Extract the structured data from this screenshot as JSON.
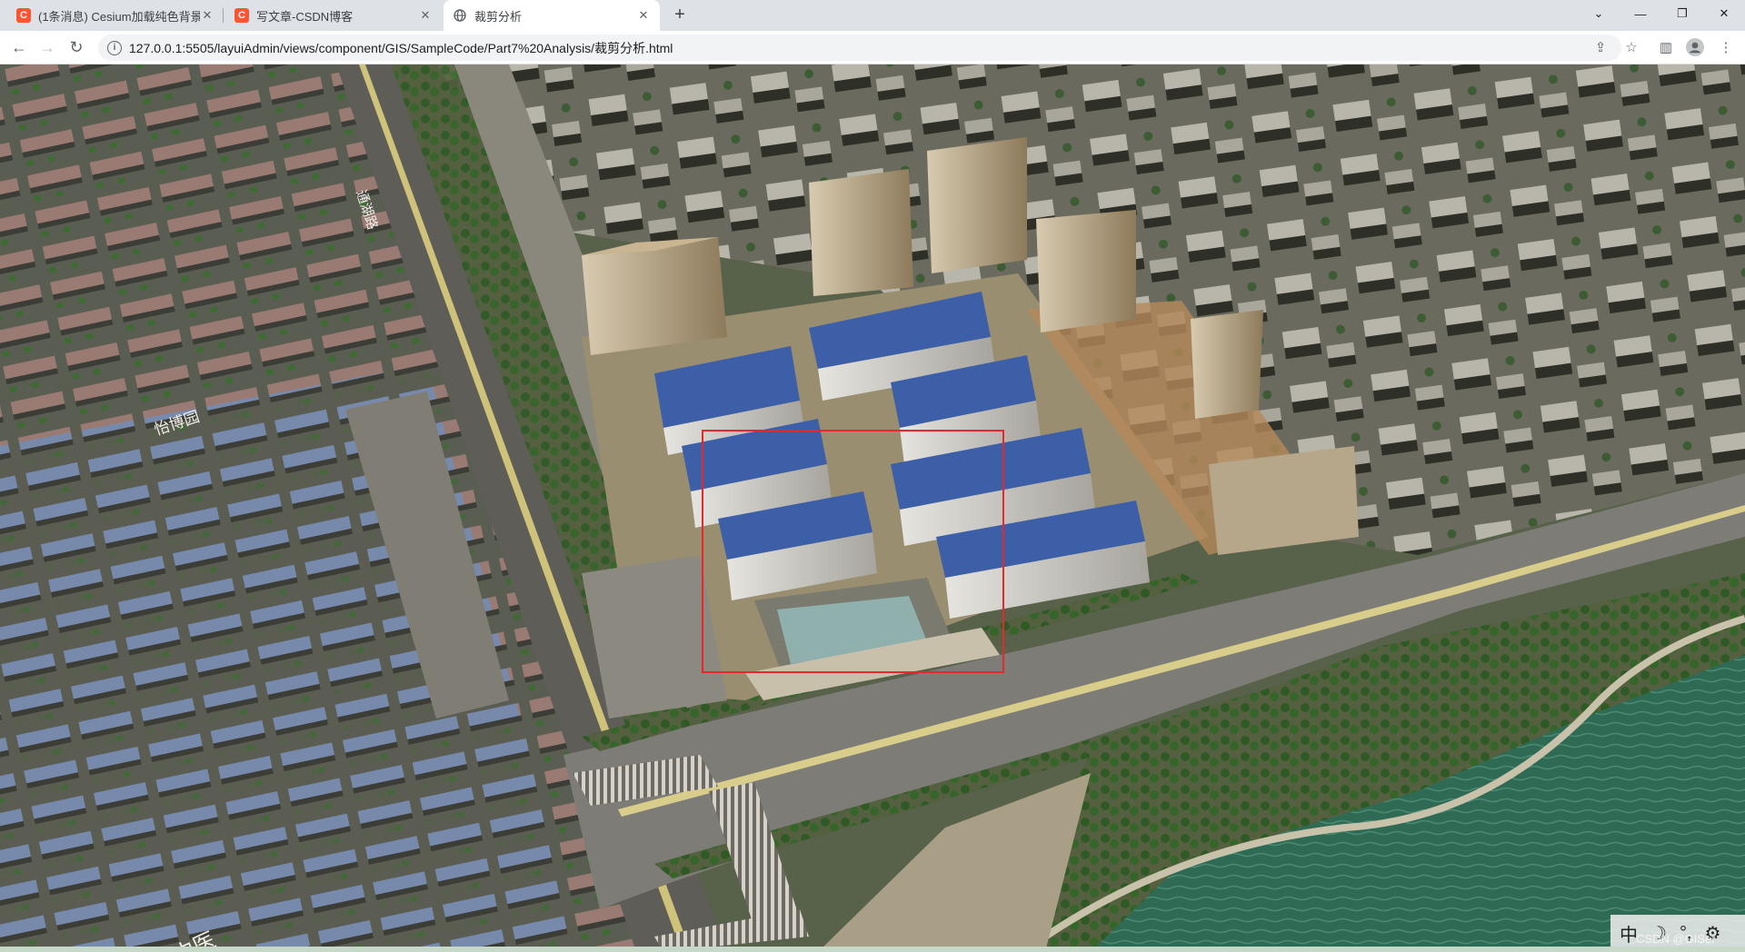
{
  "browser": {
    "tabs": [
      {
        "title": "(1条消息) Cesium加载纯色背景_",
        "favicon": "C",
        "favicon_color": "#fc5531",
        "active": false
      },
      {
        "title": "写文章-CSDN博客",
        "favicon": "C",
        "favicon_color": "#fc5531",
        "active": false
      },
      {
        "title": "裁剪分析",
        "favicon": "globe",
        "favicon_color": "#5f6368",
        "active": true
      }
    ],
    "new_tab_label": "+",
    "window_controls": {
      "tab_search": "⌄",
      "minimize": "—",
      "restore": "❐",
      "close": "✕"
    },
    "url": "127.0.0.1:5505/layuiAdmin/views/component/GIS/SampleCode/Part7%20Analysis/裁剪分析.html"
  },
  "map": {
    "labels": {
      "road_vertical": "通湖路",
      "community": "怡博园",
      "hospital": "同仁中医"
    },
    "clip_rectangle_color": "#e8262b"
  },
  "ime_bar": {
    "items": [
      "中",
      "☽",
      "°,",
      "⚙"
    ]
  },
  "watermark": "CSDN @GISer"
}
